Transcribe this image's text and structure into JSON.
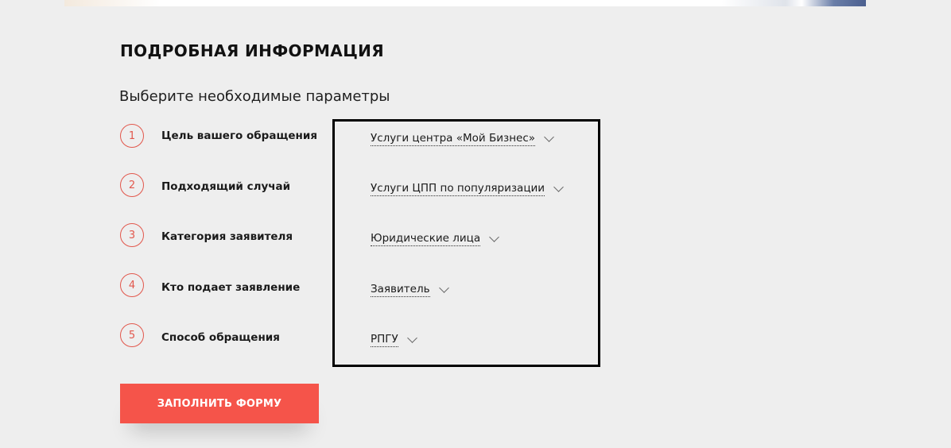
{
  "header": {
    "title": "ПОДРОБНАЯ ИНФОРМАЦИЯ",
    "subtitle": "Выберите необходимые параметры"
  },
  "steps": [
    {
      "number": "1",
      "label": "Цель вашего обращения",
      "value": "Услуги центра «Мой Бизнес»"
    },
    {
      "number": "2",
      "label": "Подходящий случай",
      "value": "Услуги ЦПП по популяризации"
    },
    {
      "number": "3",
      "label": "Категория заявителя",
      "value": "Юридические лица"
    },
    {
      "number": "4",
      "label": "Кто подает заявление",
      "value": "Заявитель"
    },
    {
      "number": "5",
      "label": "Способ обращения",
      "value": "РПГУ"
    }
  ],
  "actions": {
    "submit_label": "ЗАПОЛНИТЬ ФОРМУ"
  },
  "colors": {
    "accent": "#f5544a",
    "step_circle": "#e2574c",
    "background": "#eeeeee"
  }
}
